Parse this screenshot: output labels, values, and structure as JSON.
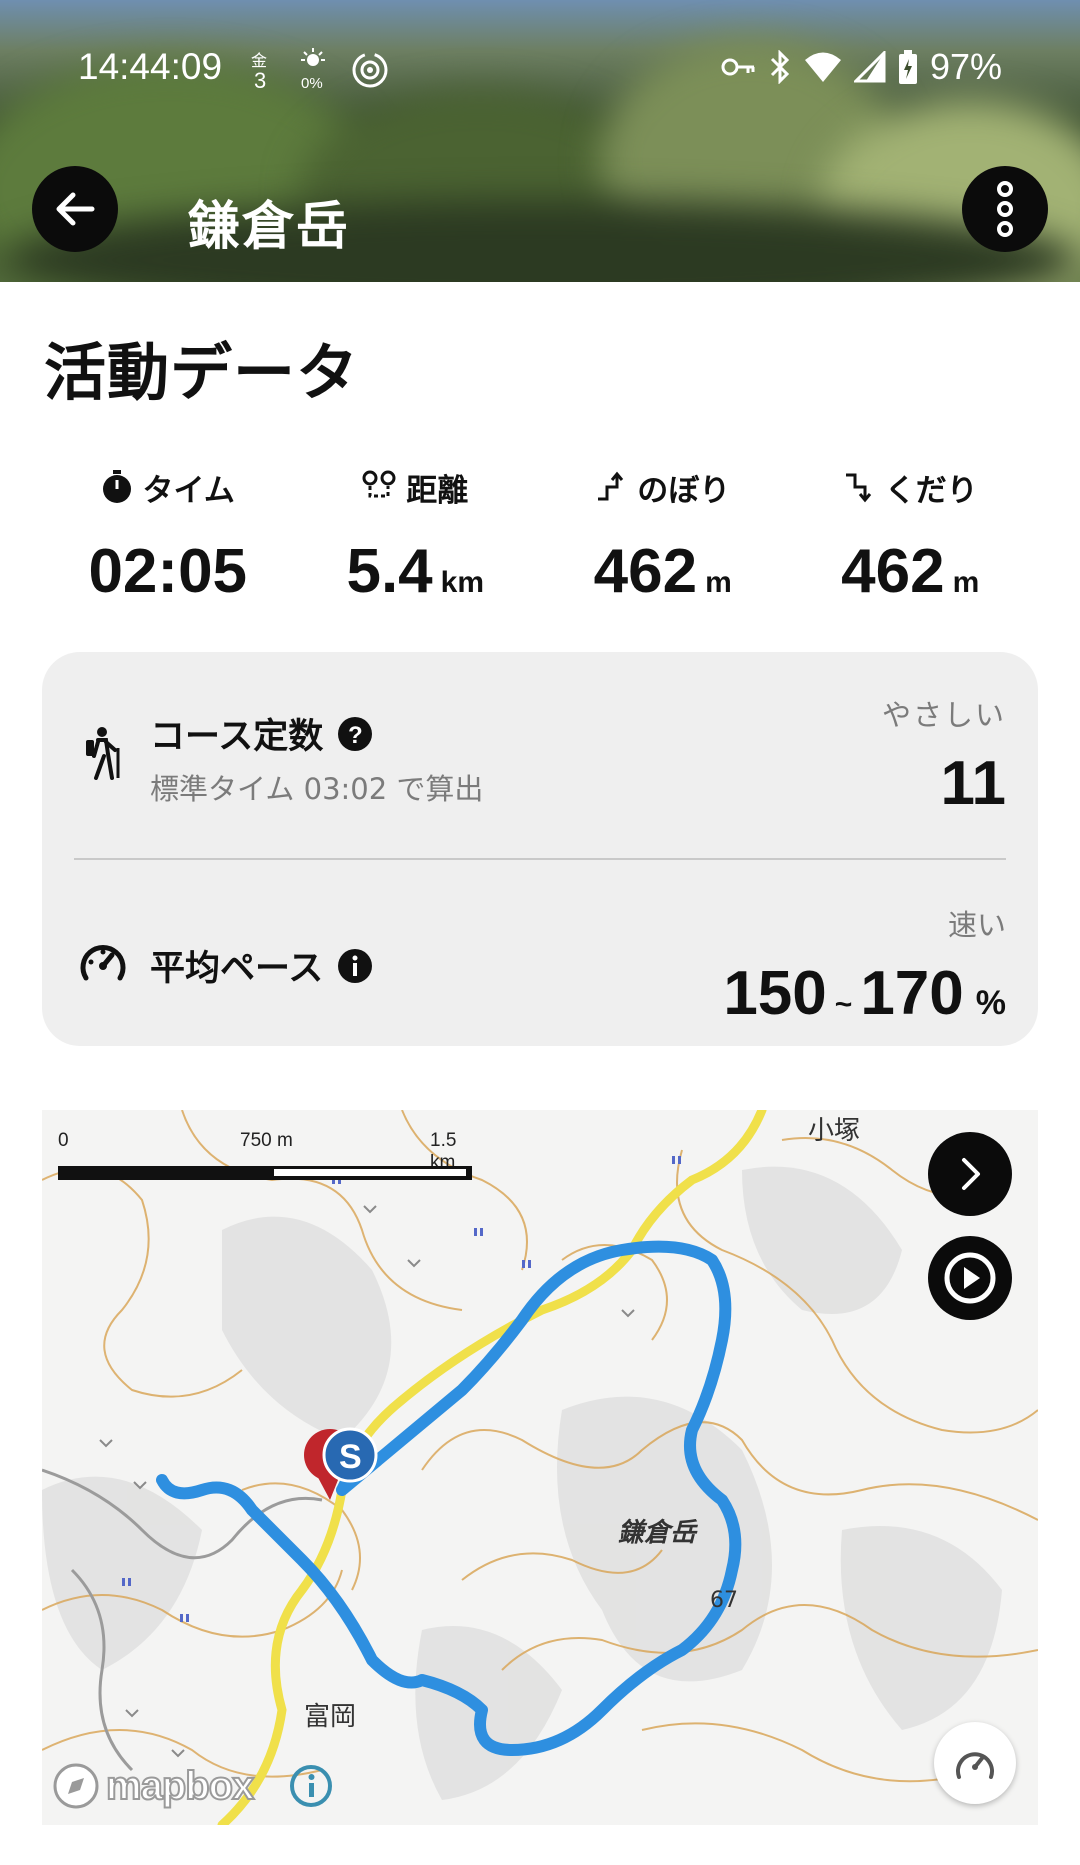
{
  "status_bar": {
    "time": "14:44:09",
    "battery": "97%"
  },
  "header": {
    "title": "鎌倉岳"
  },
  "section_title": "活動データ",
  "stats": [
    {
      "label": "タイム",
      "icon": "stopwatch-icon",
      "value": "02:05",
      "unit": ""
    },
    {
      "label": "距離",
      "icon": "route-icon",
      "value": "5.4",
      "unit": "km"
    },
    {
      "label": "のぼり",
      "icon": "ascent-icon",
      "value": "462",
      "unit": "m"
    },
    {
      "label": "くだり",
      "icon": "descent-icon",
      "value": "462",
      "unit": "m"
    }
  ],
  "course_constant": {
    "title": "コース定数",
    "subtitle": "標準タイム 03:02 で算出",
    "grade": "やさしい",
    "value": "11"
  },
  "average_pace": {
    "title": "平均ペース",
    "grade": "速い",
    "min": "150",
    "separator": "~",
    "max": "170",
    "unit": "%"
  },
  "map": {
    "scale": {
      "zero": "0",
      "mid": "750 m",
      "max": "1.5 km"
    },
    "labels": {
      "peak": "鎌倉岳",
      "village": "富岡",
      "area": "小塚",
      "elev": "67"
    },
    "route_color": "#2e8fe0",
    "road_color": "#f0e04a",
    "attribution": "mapbox"
  },
  "colors": {
    "card_bg": "#efefef",
    "subtle_text": "#7b7b7b"
  }
}
